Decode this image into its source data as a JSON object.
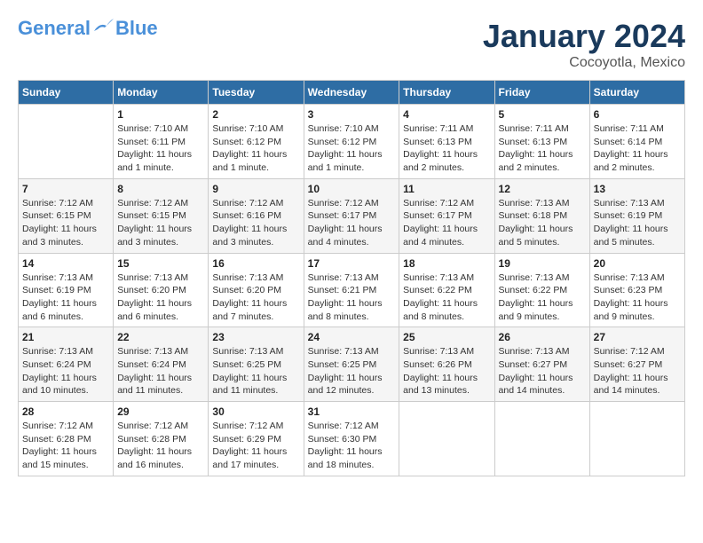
{
  "logo": {
    "line1": "General",
    "line2": "Blue"
  },
  "title": "January 2024",
  "subtitle": "Cocoyotla, Mexico",
  "weekdays": [
    "Sunday",
    "Monday",
    "Tuesday",
    "Wednesday",
    "Thursday",
    "Friday",
    "Saturday"
  ],
  "weeks": [
    [
      {
        "day": "",
        "info": ""
      },
      {
        "day": "1",
        "info": "Sunrise: 7:10 AM\nSunset: 6:11 PM\nDaylight: 11 hours\nand 1 minute."
      },
      {
        "day": "2",
        "info": "Sunrise: 7:10 AM\nSunset: 6:12 PM\nDaylight: 11 hours\nand 1 minute."
      },
      {
        "day": "3",
        "info": "Sunrise: 7:10 AM\nSunset: 6:12 PM\nDaylight: 11 hours\nand 1 minute."
      },
      {
        "day": "4",
        "info": "Sunrise: 7:11 AM\nSunset: 6:13 PM\nDaylight: 11 hours\nand 2 minutes."
      },
      {
        "day": "5",
        "info": "Sunrise: 7:11 AM\nSunset: 6:13 PM\nDaylight: 11 hours\nand 2 minutes."
      },
      {
        "day": "6",
        "info": "Sunrise: 7:11 AM\nSunset: 6:14 PM\nDaylight: 11 hours\nand 2 minutes."
      }
    ],
    [
      {
        "day": "7",
        "info": "Sunrise: 7:12 AM\nSunset: 6:15 PM\nDaylight: 11 hours\nand 3 minutes."
      },
      {
        "day": "8",
        "info": "Sunrise: 7:12 AM\nSunset: 6:15 PM\nDaylight: 11 hours\nand 3 minutes."
      },
      {
        "day": "9",
        "info": "Sunrise: 7:12 AM\nSunset: 6:16 PM\nDaylight: 11 hours\nand 3 minutes."
      },
      {
        "day": "10",
        "info": "Sunrise: 7:12 AM\nSunset: 6:17 PM\nDaylight: 11 hours\nand 4 minutes."
      },
      {
        "day": "11",
        "info": "Sunrise: 7:12 AM\nSunset: 6:17 PM\nDaylight: 11 hours\nand 4 minutes."
      },
      {
        "day": "12",
        "info": "Sunrise: 7:13 AM\nSunset: 6:18 PM\nDaylight: 11 hours\nand 5 minutes."
      },
      {
        "day": "13",
        "info": "Sunrise: 7:13 AM\nSunset: 6:19 PM\nDaylight: 11 hours\nand 5 minutes."
      }
    ],
    [
      {
        "day": "14",
        "info": "Sunrise: 7:13 AM\nSunset: 6:19 PM\nDaylight: 11 hours\nand 6 minutes."
      },
      {
        "day": "15",
        "info": "Sunrise: 7:13 AM\nSunset: 6:20 PM\nDaylight: 11 hours\nand 6 minutes."
      },
      {
        "day": "16",
        "info": "Sunrise: 7:13 AM\nSunset: 6:20 PM\nDaylight: 11 hours\nand 7 minutes."
      },
      {
        "day": "17",
        "info": "Sunrise: 7:13 AM\nSunset: 6:21 PM\nDaylight: 11 hours\nand 8 minutes."
      },
      {
        "day": "18",
        "info": "Sunrise: 7:13 AM\nSunset: 6:22 PM\nDaylight: 11 hours\nand 8 minutes."
      },
      {
        "day": "19",
        "info": "Sunrise: 7:13 AM\nSunset: 6:22 PM\nDaylight: 11 hours\nand 9 minutes."
      },
      {
        "day": "20",
        "info": "Sunrise: 7:13 AM\nSunset: 6:23 PM\nDaylight: 11 hours\nand 9 minutes."
      }
    ],
    [
      {
        "day": "21",
        "info": "Sunrise: 7:13 AM\nSunset: 6:24 PM\nDaylight: 11 hours\nand 10 minutes."
      },
      {
        "day": "22",
        "info": "Sunrise: 7:13 AM\nSunset: 6:24 PM\nDaylight: 11 hours\nand 11 minutes."
      },
      {
        "day": "23",
        "info": "Sunrise: 7:13 AM\nSunset: 6:25 PM\nDaylight: 11 hours\nand 11 minutes."
      },
      {
        "day": "24",
        "info": "Sunrise: 7:13 AM\nSunset: 6:25 PM\nDaylight: 11 hours\nand 12 minutes."
      },
      {
        "day": "25",
        "info": "Sunrise: 7:13 AM\nSunset: 6:26 PM\nDaylight: 11 hours\nand 13 minutes."
      },
      {
        "day": "26",
        "info": "Sunrise: 7:13 AM\nSunset: 6:27 PM\nDaylight: 11 hours\nand 14 minutes."
      },
      {
        "day": "27",
        "info": "Sunrise: 7:12 AM\nSunset: 6:27 PM\nDaylight: 11 hours\nand 14 minutes."
      }
    ],
    [
      {
        "day": "28",
        "info": "Sunrise: 7:12 AM\nSunset: 6:28 PM\nDaylight: 11 hours\nand 15 minutes."
      },
      {
        "day": "29",
        "info": "Sunrise: 7:12 AM\nSunset: 6:28 PM\nDaylight: 11 hours\nand 16 minutes."
      },
      {
        "day": "30",
        "info": "Sunrise: 7:12 AM\nSunset: 6:29 PM\nDaylight: 11 hours\nand 17 minutes."
      },
      {
        "day": "31",
        "info": "Sunrise: 7:12 AM\nSunset: 6:30 PM\nDaylight: 11 hours\nand 18 minutes."
      },
      {
        "day": "",
        "info": ""
      },
      {
        "day": "",
        "info": ""
      },
      {
        "day": "",
        "info": ""
      }
    ]
  ]
}
